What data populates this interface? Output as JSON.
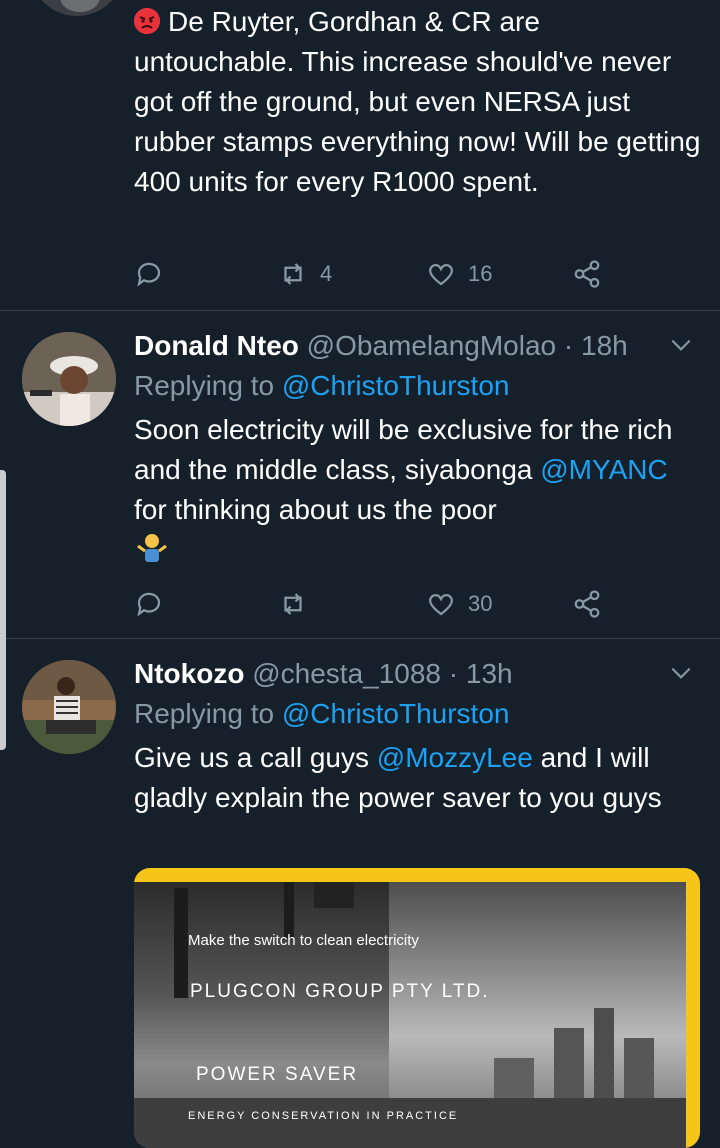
{
  "tweet1": {
    "text_before_emoji": "",
    "text": "De Ruyter, Gordhan & CR are untouchable. This increase should've never got off the ground, but even NERSA just rubber stamps everything now! Will be getting 400 units for every R1000 spent.",
    "emoji": "angry-face",
    "retweets": "4",
    "likes": "16"
  },
  "tweet2": {
    "name": "Donald Nteo",
    "handle": "@ObamelangMolao",
    "time": "· 18h",
    "replying_prefix": "Replying to ",
    "replying_to": "@ChristoThurston",
    "text_a": "Soon electricity will be exclusive for the rich and the middle class, siyabonga ",
    "mention": "@MYANC",
    "text_b": " for thinking about us the poor",
    "emoji": "person-shrugging",
    "retweets": "",
    "likes": "30"
  },
  "tweet3": {
    "name": "Ntokozo",
    "handle": "@chesta_1088",
    "time": "· 13h",
    "replying_prefix": "Replying to ",
    "replying_to": "@ChristoThurston",
    "text_a": "Give us a call guys ",
    "mention": "@MozzyLee",
    "text_b": " and I will gladly explain the power saver to you guys",
    "card": {
      "line1": "Make the switch to clean electricity",
      "line2": "PLUGCON GROUP PTY LTD.",
      "line3": "POWER SAVER",
      "line4": "ENERGY CONSERVATION IN PRACTICE"
    }
  },
  "colors": {
    "background": "#15202b",
    "link": "#1da1f2",
    "muted": "#8899a6",
    "divider": "#38444d",
    "card_accent": "#f5c518"
  }
}
